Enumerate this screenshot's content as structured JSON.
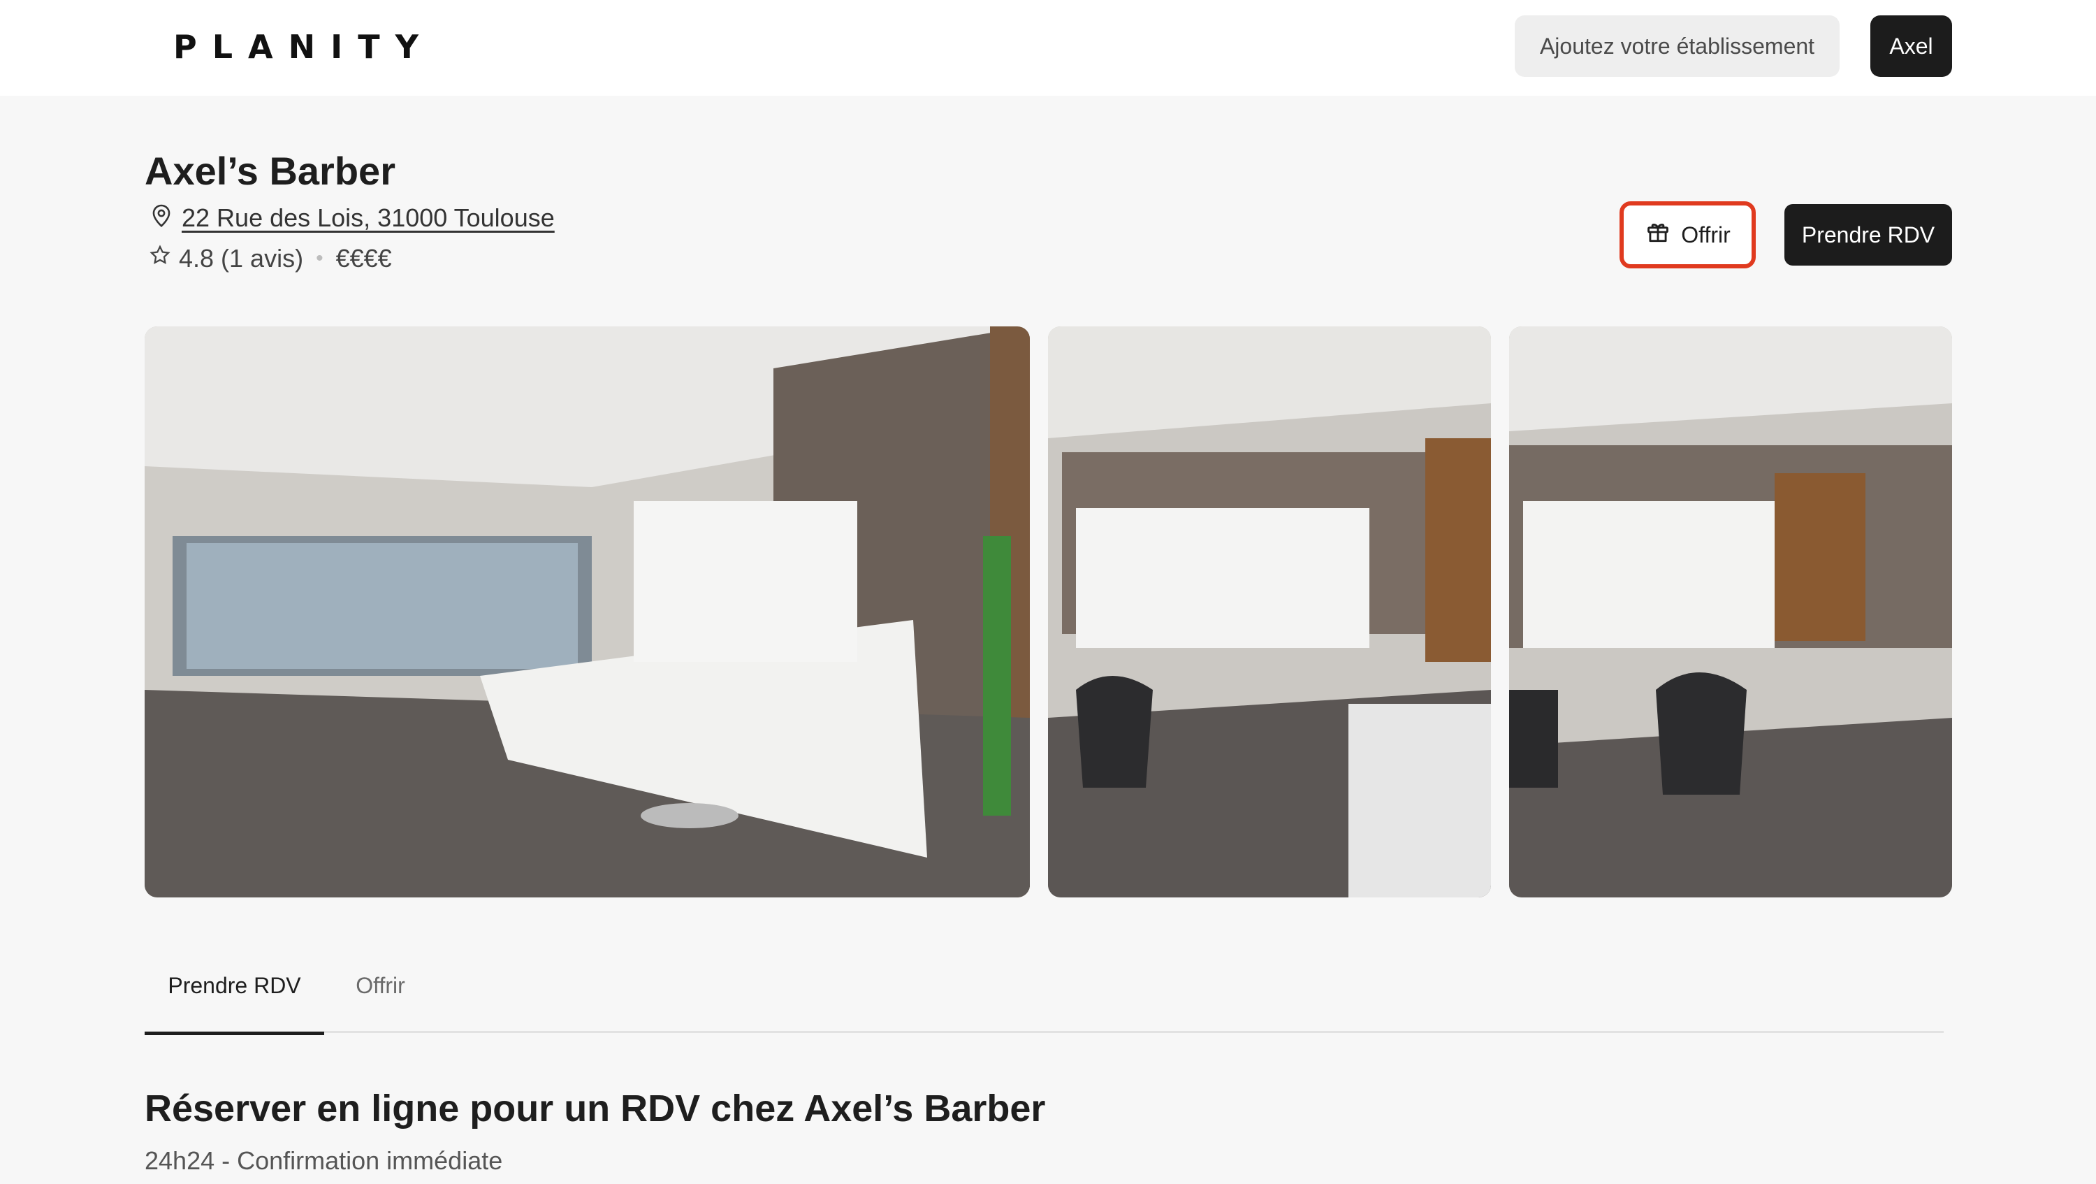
{
  "header": {
    "logo": "PLANITY",
    "add_business_label": "Ajoutez votre établissement",
    "user_label": "Axel"
  },
  "business": {
    "name": "Axel’s Barber",
    "address": "22 Rue des Lois, 31000 Toulouse",
    "rating": "4.8 (1 avis)",
    "price": "€€€€"
  },
  "actions": {
    "offer_label": "Offrir",
    "book_label": "Prendre RDV"
  },
  "tabs": [
    {
      "label": "Prendre RDV",
      "active": true
    },
    {
      "label": "Offrir",
      "active": false
    }
  ],
  "booking": {
    "title": "Réserver en ligne pour un RDV chez Axel’s Barber",
    "subtitle": "24h24 - Confirmation immédiate"
  },
  "colors": {
    "accent_dark": "#1c1c1c",
    "highlight": "#e03a1f"
  },
  "icons": {
    "address": "map-pin-icon",
    "rating": "star-icon",
    "offer": "gift-icon"
  }
}
